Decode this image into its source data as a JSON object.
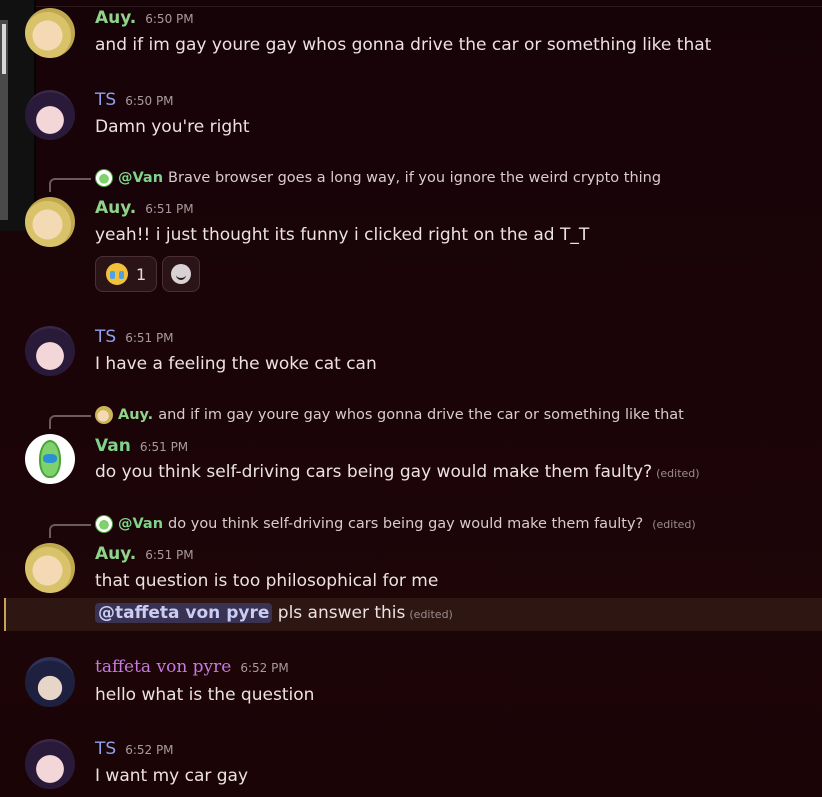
{
  "messages": [
    {
      "author": "Auy.",
      "time": "6:50 PM",
      "text": "and if im gay youre gay whos gonna drive the car or something like that"
    },
    {
      "author": "TS",
      "time": "6:50 PM",
      "text": "Damn you're right"
    },
    {
      "reply": {
        "author": "@Van",
        "text": "Brave browser goes a long way, if you ignore the weird crypto thing"
      },
      "author": "Auy.",
      "time": "6:51 PM",
      "text": "yeah!! i just thought its funny i clicked right on the ad T_T",
      "reactions": [
        {
          "emoji": "crying-face",
          "count": "1"
        }
      ]
    },
    {
      "author": "TS",
      "time": "6:51 PM",
      "text": "I have a feeling the woke cat can"
    },
    {
      "reply": {
        "author": "Auy.",
        "text": "and if im gay youre gay whos gonna drive the car or something like that"
      },
      "author": "Van",
      "time": "6:51 PM",
      "text": "do you think self-driving cars being gay would make them faulty?",
      "edited": "(edited)"
    },
    {
      "reply": {
        "author": "@Van",
        "text": "do you think self-driving cars being gay would make them faulty?",
        "edited": "(edited)"
      },
      "author": "Auy.",
      "time": "6:51 PM",
      "text": "that question is too philosophical for me"
    },
    {
      "mention": "@taffeta von pyre",
      "text": "pls answer this",
      "edited": "(edited)"
    },
    {
      "author": "taffeta von pyre",
      "time": "6:52 PM",
      "text": "hello what is the question"
    },
    {
      "author": "TS",
      "time": "6:52 PM",
      "text": "I want my car gay"
    }
  ],
  "colors": {
    "background": "#1a0408",
    "auy": "#8fd48a",
    "ts": "#8fa2ee",
    "van": "#7fd38a",
    "taffeta": "#c77ae0",
    "mention_highlight": "#c9a25a"
  }
}
